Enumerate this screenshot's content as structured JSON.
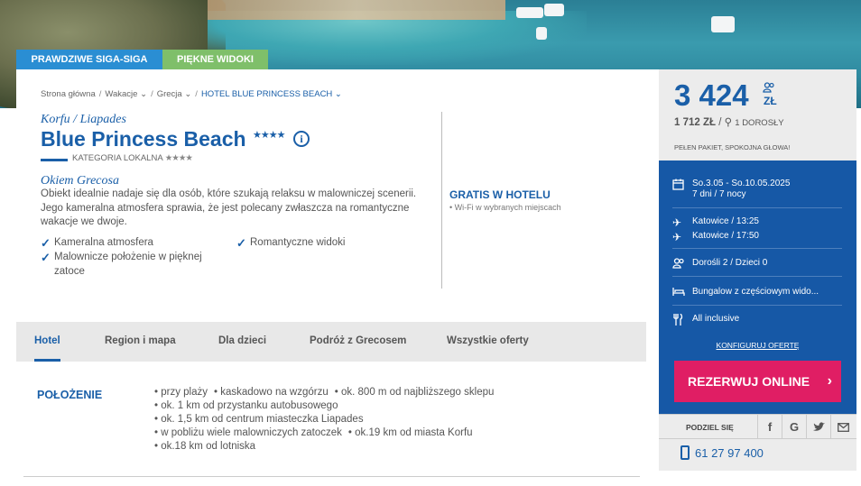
{
  "badges": {
    "blue": "PRAWDZIWE SIGA-SIGA",
    "green": "PIĘKNE WIDOKI"
  },
  "breadcrumb": [
    "Strona główna",
    "Wakacje",
    "Grecja",
    "HOTEL BLUE PRINCESS BEACH"
  ],
  "hotel": {
    "region": "Korfu / Liapades",
    "name": "Blue Princess Beach",
    "stars": "★★★★",
    "category_label": "KATEGORIA LOKALNA",
    "category_stars": "★★★★"
  },
  "okiem": {
    "title": "Okiem Grecosa",
    "text": "Obiekt idealnie nadaje się dla osób, które szukają relaksu w malowniczej scenerii. Jego kameralna atmosfera sprawia, że jest polecany zwłaszcza na romantyczne wakacje we dwoje."
  },
  "features": [
    "Kameralna atmosfera",
    "Romantyczne widoki",
    "Malownicze położenie w pięknej zatoce"
  ],
  "gratis": {
    "title": "GRATIS W HOTELU",
    "item": "• Wi-Fi w wybranych miejscach"
  },
  "tabs": [
    "Hotel",
    "Region i mapa",
    "Dla dzieci",
    "Podróż z Grecosem",
    "Wszystkie oferty"
  ],
  "polozenie": {
    "title": "POŁOŻENIE",
    "rows": [
      [
        "• przy plaży",
        "• kaskadowo na wzgórzu",
        "• ok. 800 m od najbliższego sklepu"
      ],
      [
        "• ok. 1 km od przystanku autobusowego"
      ],
      [
        "• ok. 1,5 km od centrum miasteczka Liapades"
      ],
      [
        "• w pobliżu wiele malowniczych zatoczek",
        "• ok.19 km od miasta Korfu"
      ],
      [
        "• ok.18 km od lotniska"
      ]
    ]
  },
  "sidebar": {
    "price": "3 424",
    "currency": "ZŁ",
    "per_person_price": "1 712 ZŁ",
    "per_person_label": "1 DOROSŁY",
    "pakiet": "PEŁEN PAKIET, SPOKOJNA GŁOWA!",
    "dates": "So.3.05 - So.10.05.2025",
    "nights": "7 dni / 7 nocy",
    "depart": "Katowice / 13:25",
    "return": "Katowice / 17:50",
    "people": "Dorośli 2 / Dzieci 0",
    "room": "Bungalow z częściowym wido...",
    "board": "All inclusive",
    "configure": "KONFIGURUJ OFERTĘ",
    "reserve": "REZERWUJ ONLINE",
    "share": "PODZIEL SIĘ",
    "phone": "61 27 97 400"
  },
  "colors": {
    "brand_blue": "#1a5fa8",
    "trip_panel": "#1658a6",
    "reserve": "#e01e64",
    "badge_blue": "#2a8ed3",
    "badge_green": "#7fbf6a"
  }
}
